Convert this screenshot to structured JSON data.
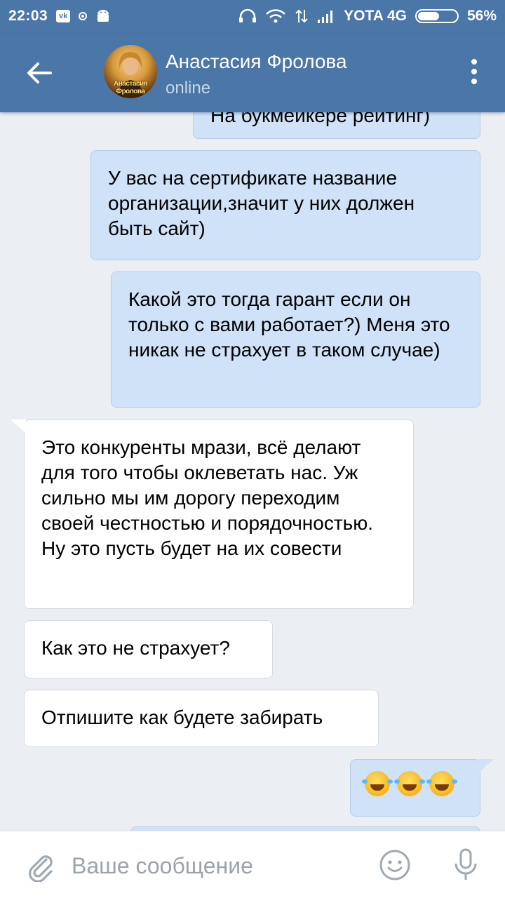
{
  "status_bar": {
    "time": "22:03",
    "vk_badge": "vk",
    "network": "4G",
    "carrier": "YOTA 4G",
    "battery_percent_label": "56%",
    "battery_level": 0.56
  },
  "header": {
    "contact_name": "Анастасия Фролова",
    "contact_status": "online",
    "avatar_text": "Анастасия Фролова"
  },
  "messages": [
    {
      "direction": "out",
      "text": "На букмейкере рейтинг)"
    },
    {
      "direction": "out",
      "text": "У вас на сертификате название организации,значит у них должен быть сайт)"
    },
    {
      "direction": "out",
      "text": "Какой это тогда гарант если он только с вами работает?) Меня это никак не страхует в таком случае)"
    },
    {
      "direction": "in",
      "text": "Это конкуренты мрази, всё делают для того чтобы оклеветать нас. Уж сильно мы им дорогу переходим своей честностью и порядочностью. Ну это пусть будет на их совести"
    },
    {
      "direction": "in",
      "text": "Как это не страхует?"
    },
    {
      "direction": "in",
      "text": "Отпишите как будете забирать"
    },
    {
      "direction": "out",
      "text": "🤣🤣🤣"
    }
  ],
  "composer": {
    "placeholder": "Ваше сообщение",
    "value": ""
  },
  "icons": {
    "back": "arrow-left-icon",
    "menu": "more-vertical-icon",
    "attach": "paperclip-icon",
    "emoji": "smile-icon",
    "mic": "microphone-icon"
  },
  "colors": {
    "header_bg": "#4a76a8",
    "chat_bg": "#ebeef2",
    "outgoing_bubble": "#cfe2f8",
    "incoming_bubble": "#ffffff"
  }
}
